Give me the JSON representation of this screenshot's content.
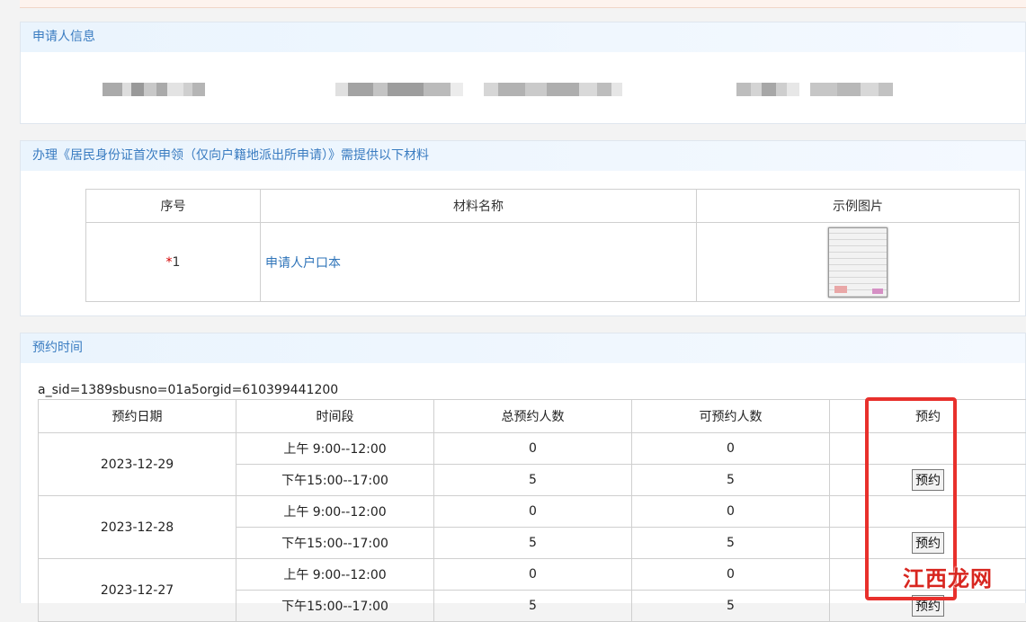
{
  "applicant": {
    "header": "申请人信息"
  },
  "materials": {
    "header": "办理《居民身份证首次申领（仅向户籍地派出所申请）》需提供以下材料",
    "columns": [
      "序号",
      "材料名称",
      "示例图片"
    ],
    "rows": [
      {
        "required_mark": "*",
        "index": "1",
        "name": "申请人户口本"
      }
    ]
  },
  "reservation": {
    "header": "预约时间",
    "sid_text": "a_sid=1389sbusno=01a5orgid=610399441200",
    "columns": [
      "预约日期",
      "时间段",
      "总预约人数",
      "可预约人数",
      "预约"
    ],
    "button_label": "预约",
    "rows": [
      {
        "date": "2023-12-29",
        "slot": "上午 9:00--12:00",
        "total": "0",
        "available": "0"
      },
      {
        "slot": "下午15:00--17:00",
        "total": "5",
        "available": "5",
        "bookable": true
      },
      {
        "date": "2023-12-28",
        "slot": "上午 9:00--12:00",
        "total": "0",
        "available": "0"
      },
      {
        "slot": "下午15:00--17:00",
        "total": "5",
        "available": "5",
        "bookable": true
      },
      {
        "date": "2023-12-27",
        "slot": "上午 9:00--12:00",
        "total": "0",
        "available": "0"
      },
      {
        "slot": "下午15:00--17:00",
        "total": "5",
        "available": "5",
        "bookable": true
      }
    ]
  },
  "watermark": "江西龙网",
  "colors": {
    "header_text": "#3a7cc1",
    "highlight": "#e8302c",
    "link": "#2f74b9"
  }
}
